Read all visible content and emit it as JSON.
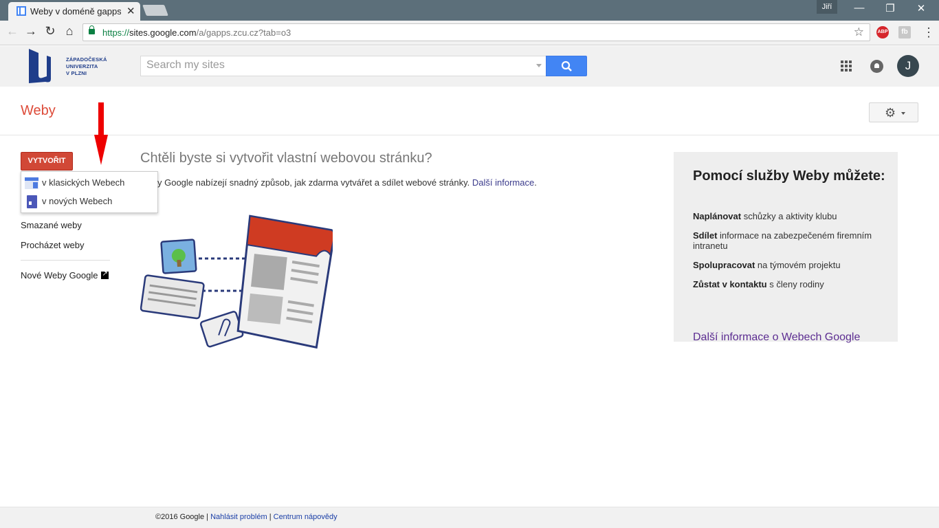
{
  "browser": {
    "tab_title": "Weby v doméně gapps.zcu.cz",
    "tab_close": "✕",
    "profile": "Jiří",
    "window_minimize": "—",
    "window_restore": "❐",
    "window_close": "✕",
    "url_https": "https://",
    "url_host": "sites.google.com",
    "url_path": "/a/gapps.zcu.cz?tab=o3",
    "ext_abp": "ABP",
    "ext_fb": "fb"
  },
  "header": {
    "logo_lines": [
      "ZÁPADOČESKÁ",
      "UNIVERZITA",
      "V PLZNI"
    ],
    "search_placeholder": "Search my sites",
    "avatar_letter": "J"
  },
  "page": {
    "title": "Weby"
  },
  "sidebar": {
    "create_label": "VYTVOŘIT",
    "dropdown": [
      {
        "label": "v klasických Webech",
        "icon": "classic-sites-icon"
      },
      {
        "label": "v nových Webech",
        "icon": "new-sites-icon"
      }
    ],
    "links": [
      "Smazané weby",
      "Procházet weby"
    ],
    "new_sites_link": "Nové Weby Google"
  },
  "main": {
    "headline": "Chtěli byste si vytvořit vlastní webovou stránku?",
    "intro_text": "y Google nabízejí snadný způsob, jak zdarma vytvářet a sdílet webové stránky. ",
    "intro_link": "Další informace",
    "intro_end": "."
  },
  "info_panel": {
    "title": "Pomocí služby Weby můžete:",
    "items": [
      {
        "bold": "Naplánovat",
        "rest": " schůzky a aktivity klubu"
      },
      {
        "bold": "Sdílet",
        "rest": " informace na zabezpečeném firemním intranetu"
      },
      {
        "bold": "Spolupracovat",
        "rest": " na týmovém projektu"
      },
      {
        "bold": "Zůstat v kontaktu",
        "rest": " s členy rodiny"
      }
    ],
    "more_link": "Další informace o Webech Google"
  },
  "footer": {
    "copyright": "©2016 Google",
    "sep": " | ",
    "report": "Nahlásit problém",
    "help": "Centrum nápovědy"
  },
  "colors": {
    "accent_red": "#dd4b39",
    "create_button": "#d14836",
    "search_blue": "#4285f4"
  }
}
